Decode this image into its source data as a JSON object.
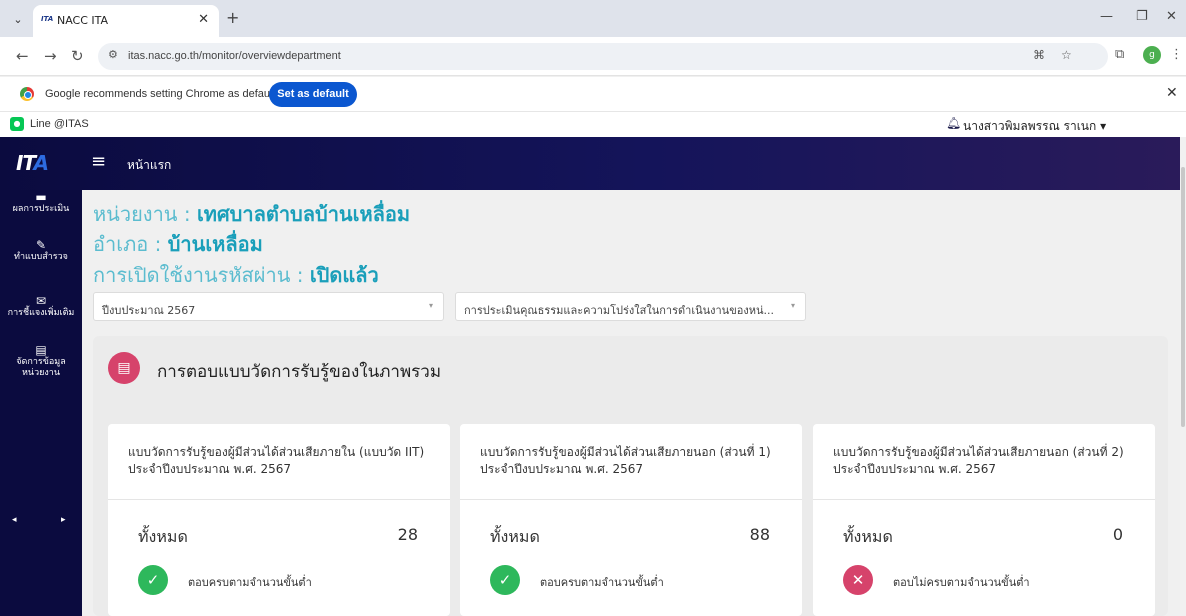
{
  "browser": {
    "tab_title": "NACC ITA",
    "tab_favicon": "ITA",
    "url": "itas.nacc.go.th/monitor/overviewdepartment",
    "infobar_message": "Google recommends setting Chrome as default",
    "infobar_button": "Set as default",
    "profile_initial": "g",
    "bookmark_label": "Line @ITAS",
    "user_name": "นางสาวพิมลพรรณ ราเนก ▾"
  },
  "app": {
    "logo_a": "IT",
    "logo_b": "A",
    "home_label": "หน้าแรก"
  },
  "sidebar": {
    "items": [
      {
        "icon": "▬",
        "label": "ผลการประเมิน"
      },
      {
        "icon": "✎",
        "label": "ทำแบบสำรวจ"
      },
      {
        "icon": "✉",
        "label": "การชี้แจงเพิ่มเติม"
      },
      {
        "icon": "▤",
        "label": "จัดการข้อมูล"
      },
      {
        "icon": "",
        "label": "หน่วยงาน"
      }
    ]
  },
  "info": {
    "agency_label": "หน่วยงาน : ",
    "agency_value": "เทศบาลตำบลบ้านเหลื่อม",
    "district_label": "อำเภอ : ",
    "district_value": "บ้านเหลื่อม",
    "password_label": "การเปิดใช้งานรหัสผ่าน : ",
    "password_value": "เปิดแล้ว"
  },
  "filters": {
    "year": "ปีงบประมาณ 2567",
    "assessment": "การประเมินคุณธรรมและความโปร่งใสในการดำเนินงานของหน่..."
  },
  "panel": {
    "title": "การตอบแบบวัดการรับรู้ของในภาพรวม"
  },
  "cards": [
    {
      "title": "แบบวัดการรับรู้ของผู้มีส่วนได้ส่วนเสียภายใน (แบบวัด IIT) ประจำปีงบประมาณ พ.ศ. 2567",
      "total_label": "ทั้งหมด",
      "total": "28",
      "status_icon": "✓",
      "status_text": "ตอบครบตามจำนวนขั้นต่ำ",
      "status_color": "#2eb85c"
    },
    {
      "title": "แบบวัดการรับรู้ของผู้มีส่วนได้ส่วนเสียภายนอก (ส่วนที่ 1) ประจำปีงบประมาณ พ.ศ. 2567",
      "total_label": "ทั้งหมด",
      "total": "88",
      "status_icon": "✓",
      "status_text": "ตอบครบตามจำนวนขั้นต่ำ",
      "status_color": "#2eb85c"
    },
    {
      "title": "แบบวัดการรับรู้ของผู้มีส่วนได้ส่วนเสียภายนอก (ส่วนที่ 2) ประจำปีงบประมาณ พ.ศ. 2567",
      "total_label": "ทั้งหมด",
      "total": "0",
      "status_icon": "✕",
      "status_text": "ตอบไม่ครบตามจำนวนขั้นต่ำ",
      "status_color": "#d6436b"
    }
  ]
}
